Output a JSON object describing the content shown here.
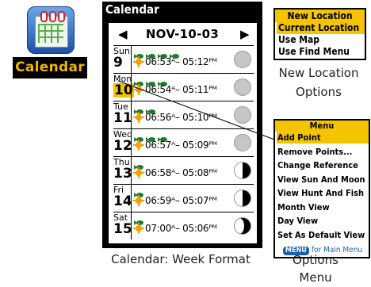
{
  "app_icon": {
    "label": "Calendar"
  },
  "calendar": {
    "title": "Calendar",
    "nav": {
      "prev": "◀",
      "date": "NOV-10-03",
      "next": "▶"
    },
    "days": [
      {
        "name": "Sun",
        "num": "9",
        "times": "06:53ᴬ– 05:12ᴾᴹ",
        "fish": 4,
        "moon": "full",
        "selected": false
      },
      {
        "name": "Mon",
        "num": "10",
        "times": "06:54ᴬ– 05:11ᴾᴹ",
        "fish": 3,
        "moon": "full",
        "selected": true
      },
      {
        "name": "Tue",
        "num": "11",
        "times": "06:56ᴬ– 05:10ᴾᴹ",
        "fish": 2,
        "moon": "full",
        "selected": false
      },
      {
        "name": "Wed",
        "num": "12",
        "times": "06:57ᴬ– 05:09ᴾᴹ",
        "fish": 3,
        "moon": "full",
        "selected": false
      },
      {
        "name": "Thu",
        "num": "13",
        "times": "06:58ᴬ– 05:08ᴾᴹ",
        "fish": 1,
        "moon": "half",
        "selected": false
      },
      {
        "name": "Fri",
        "num": "14",
        "times": "06:59ᴬ– 05:07ᴾᴹ",
        "fish": 1,
        "moon": "half",
        "selected": false
      },
      {
        "name": "Sat",
        "num": "15",
        "times": "07:00ᴬ– 05:06ᴾᴹ",
        "fish": 1,
        "moon": "gibbous",
        "selected": false
      }
    ],
    "caption": "Calendar: Week Format"
  },
  "new_location": {
    "title": "New Location",
    "items": [
      "Current Location",
      "Use Map",
      "Use Find Menu"
    ],
    "selected_index": 0,
    "caption_line1": "New Location",
    "caption_line2": "Options"
  },
  "options_menu": {
    "title": "Menu",
    "items": [
      "Add Point",
      "Remove Points...",
      "Change Reference",
      "View Sun And Moon",
      "View Hunt And Fish",
      "Month View",
      "Day View",
      "Set As Default View"
    ],
    "selected_index": 0,
    "footer_key": "MENU",
    "footer_text": "for Main Menu",
    "caption_line1": "Options",
    "caption_line2": "Menu"
  },
  "colors": {
    "highlight": "#f4c400",
    "fish": "#1f7a2e",
    "sun": "#f4a000",
    "menu_key": "#1c5faa"
  }
}
